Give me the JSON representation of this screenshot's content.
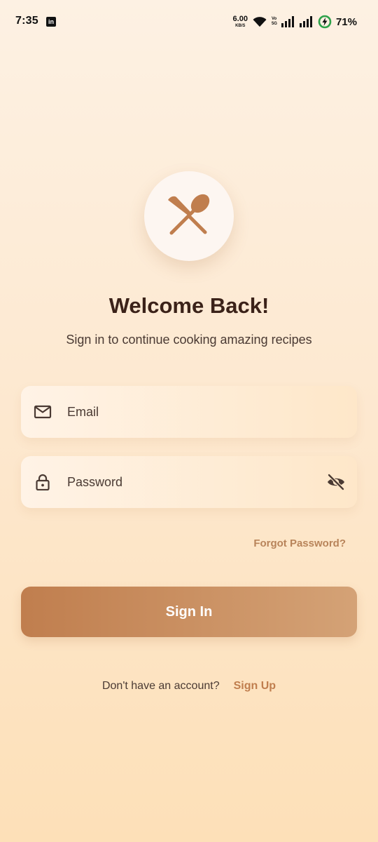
{
  "status_bar": {
    "time": "7:35",
    "app_icon": "linkedin-icon",
    "app_icon_glyph": "in",
    "net_speed_value": "6.00",
    "net_speed_unit": "KB/S",
    "volte_top": "Vo",
    "volte_bottom": "5G",
    "battery_percent": "71%"
  },
  "logo": {
    "icon": "cutlery-icon",
    "color": "#c07e4e"
  },
  "title": "Welcome Back!",
  "subtitle": "Sign in to continue cooking amazing recipes",
  "email_field": {
    "placeholder": "Email",
    "value": "",
    "icon": "mail-icon"
  },
  "password_field": {
    "placeholder": "Password",
    "value": "",
    "icon": "lock-icon",
    "toggle_icon": "eye-off-icon"
  },
  "forgot_password": "Forgot Password?",
  "sign_in_button": "Sign In",
  "footer": {
    "question": "Don't have an account?",
    "sign_up_link": "Sign Up"
  },
  "colors": {
    "accent": "#c07e4e",
    "accent_light": "#d4a276",
    "text_dark": "#3b2219",
    "background_top": "#fdf1e3",
    "background_bottom": "#fde0b8"
  }
}
